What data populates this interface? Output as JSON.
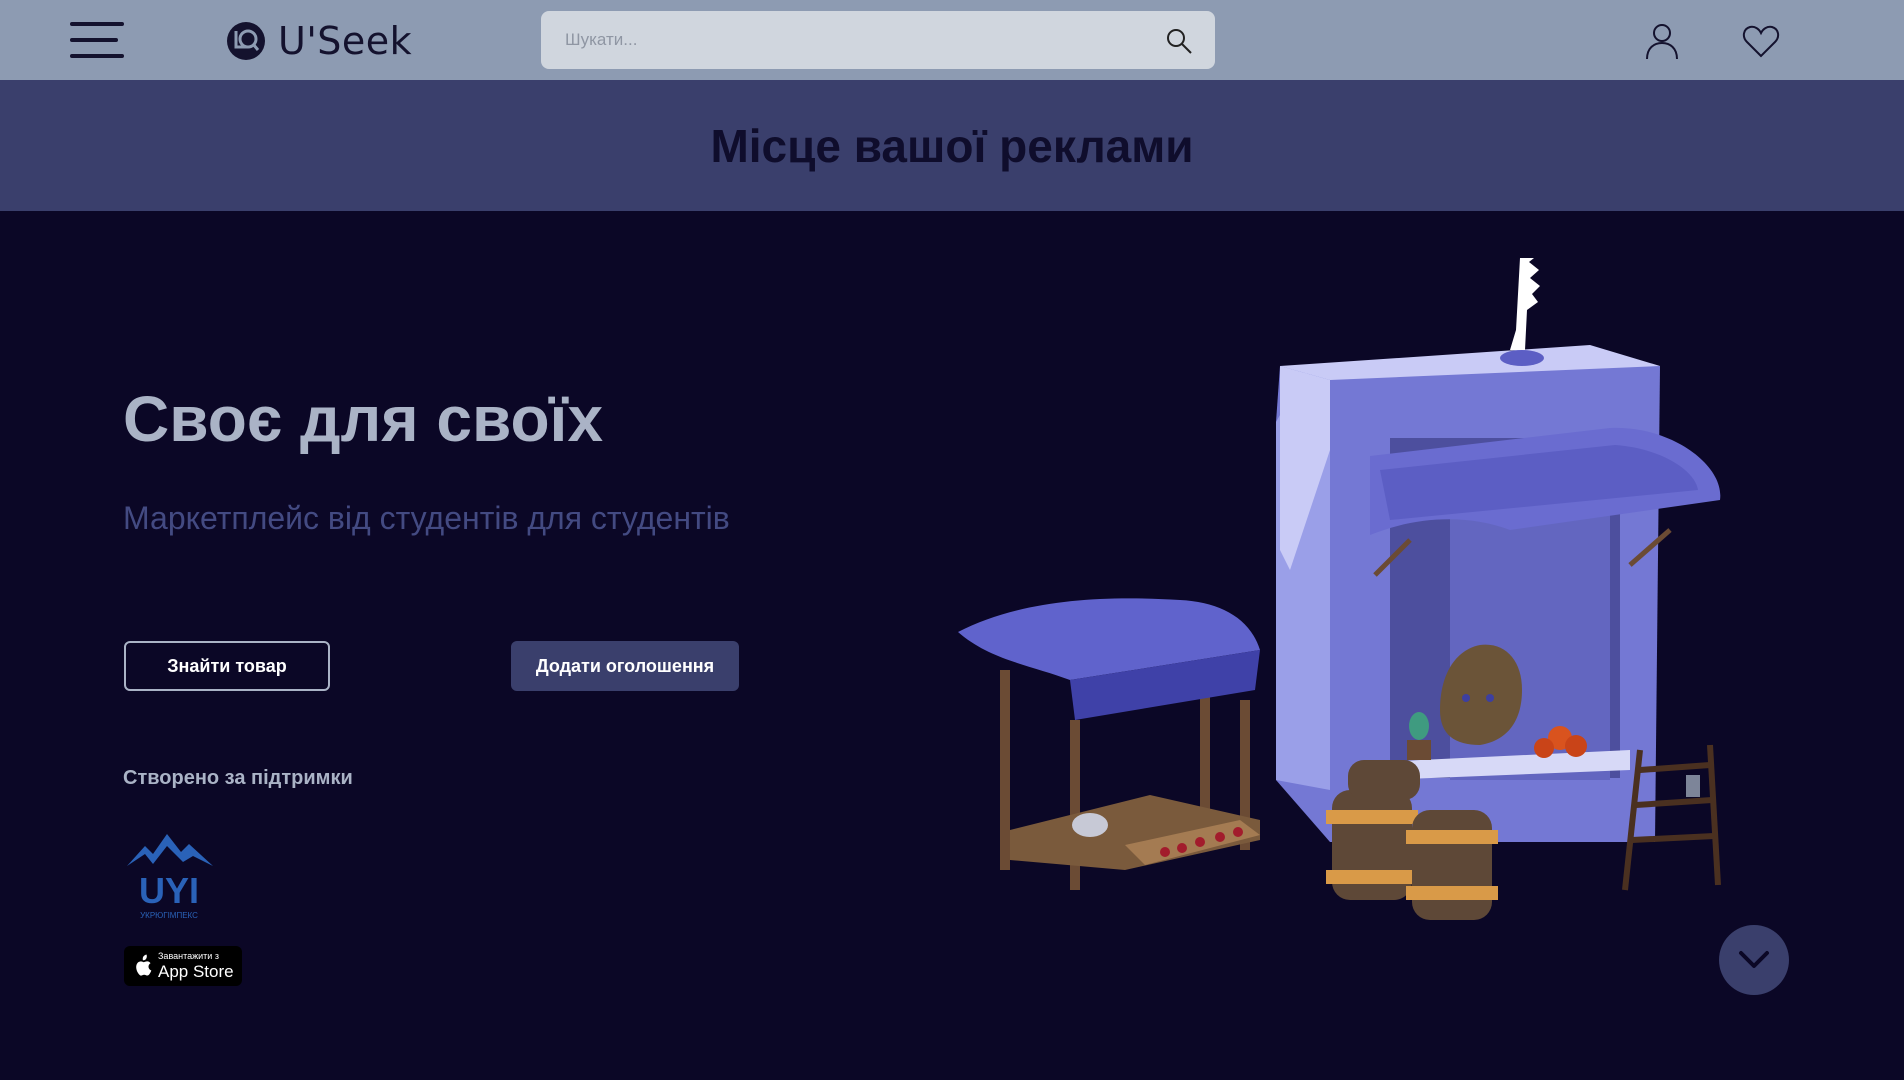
{
  "header": {
    "logo_text": "U'Seek",
    "search": {
      "placeholder": "Шукати..."
    }
  },
  "ad_banner": {
    "text": "Місце вашої реклами"
  },
  "hero": {
    "title": "Своє для своїх",
    "subtitle": "Маркетплейс від студентів для студентів",
    "find_button": "Знайти товар",
    "add_button": "Додати оголошення",
    "support_label": "Створено за підтримки",
    "partner": {
      "logo_text": "UYI",
      "logo_subtext": "УКРЮГІМПЕКС"
    },
    "appstore": {
      "small": "Завантажити з",
      "big": "App Store"
    }
  },
  "colors": {
    "header_bg": "#8d9bb2",
    "banner_bg": "#3a3f6c",
    "page_bg": "#0b0726",
    "accent": "#3a3f6c",
    "stall": "#7b7fd6"
  },
  "icons": [
    "menu-icon",
    "logo-icon",
    "search-icon",
    "user-icon",
    "heart-icon",
    "apple-icon",
    "chevron-down-icon"
  ]
}
